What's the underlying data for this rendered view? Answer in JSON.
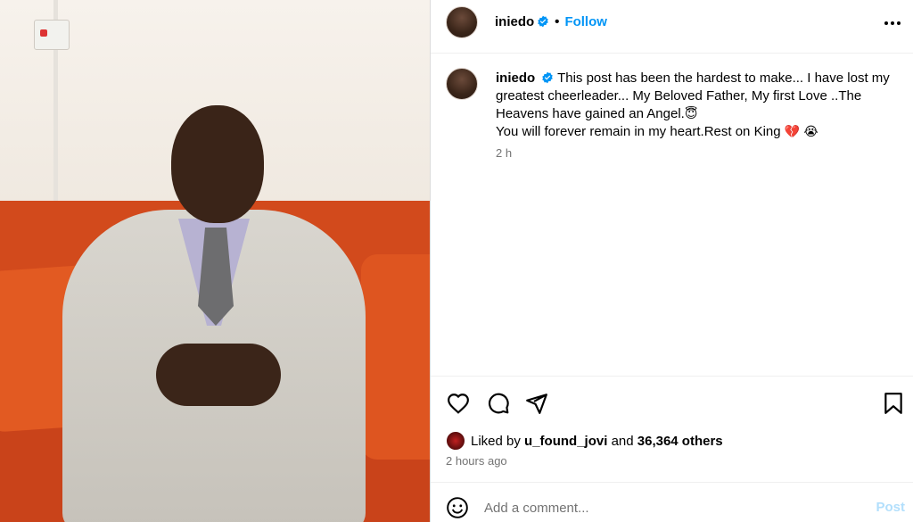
{
  "post": {
    "username": "iniedo",
    "follow_label": "Follow",
    "separator": "•"
  },
  "caption": {
    "username": "iniedo",
    "line1": "This post has been the hardest to make... I have lost my greatest cheerleader... My Beloved Father, My first Love ..The Heavens have gained an Angel.",
    "emoji_angel": "😇",
    "line2": "You will forever remain in my heart.Rest on King",
    "emoji_heart": "💔",
    "emoji_cry": "😭",
    "time": "2 h"
  },
  "likes": {
    "prefix": "Liked by",
    "user": "u_found_jovi",
    "joiner": "and",
    "count_text": "36,364 others"
  },
  "posted_time": "2 hours ago",
  "comment": {
    "placeholder": "Add a comment...",
    "post_label": "Post"
  },
  "icons": {
    "verified": "verified-badge-icon",
    "more": "more-options-icon",
    "like": "heart-icon",
    "comment": "comment-icon",
    "share": "share-icon",
    "save": "bookmark-icon",
    "emoji": "emoji-icon"
  },
  "colors": {
    "accent": "#0095f6",
    "muted": "#737373",
    "post_disabled": "#b2dffc"
  }
}
